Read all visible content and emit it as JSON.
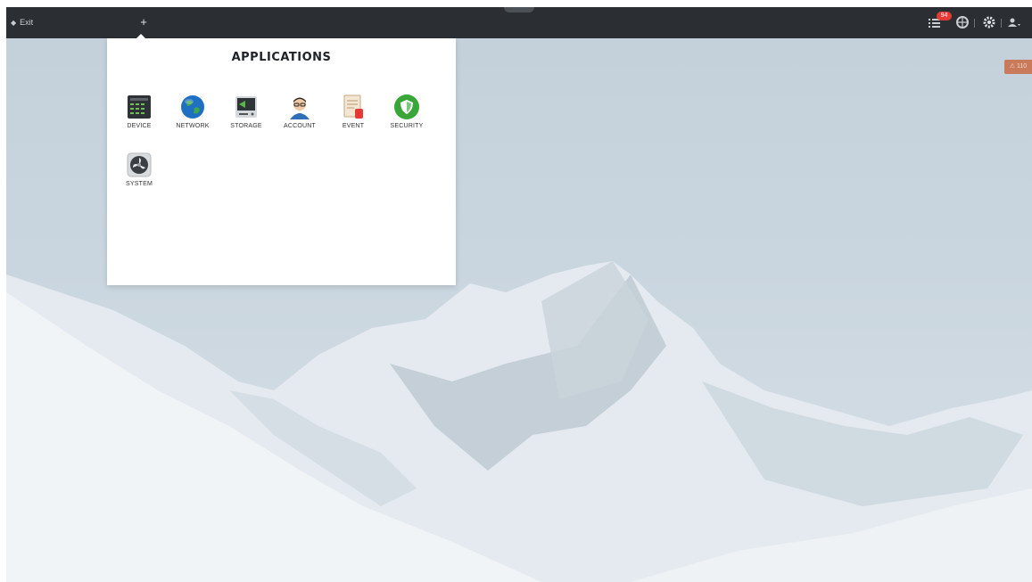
{
  "topbar": {
    "exit_label": "Exit",
    "add_label": "+",
    "notification_count": "94"
  },
  "alarm_badge": {
    "text": "⚠ 110"
  },
  "apps_panel": {
    "title": "APPLICATIONS",
    "apps": [
      {
        "label": "DEVICE",
        "icon": "device-icon"
      },
      {
        "label": "NETWORK",
        "icon": "globe-icon"
      },
      {
        "label": "STORAGE",
        "icon": "hard-drive-icon"
      },
      {
        "label": "ACCOUNT",
        "icon": "user-avatar-icon"
      },
      {
        "label": "EVENT",
        "icon": "event-log-icon"
      },
      {
        "label": "SECURITY",
        "icon": "shield-icon"
      },
      {
        "label": "SYSTEM",
        "icon": "system-fan-icon"
      }
    ]
  },
  "colors": {
    "topbar_bg": "#2b2f33",
    "badge_red": "#e53935",
    "security_green": "#3aa63a",
    "network_blue": "#1f6fc2"
  }
}
